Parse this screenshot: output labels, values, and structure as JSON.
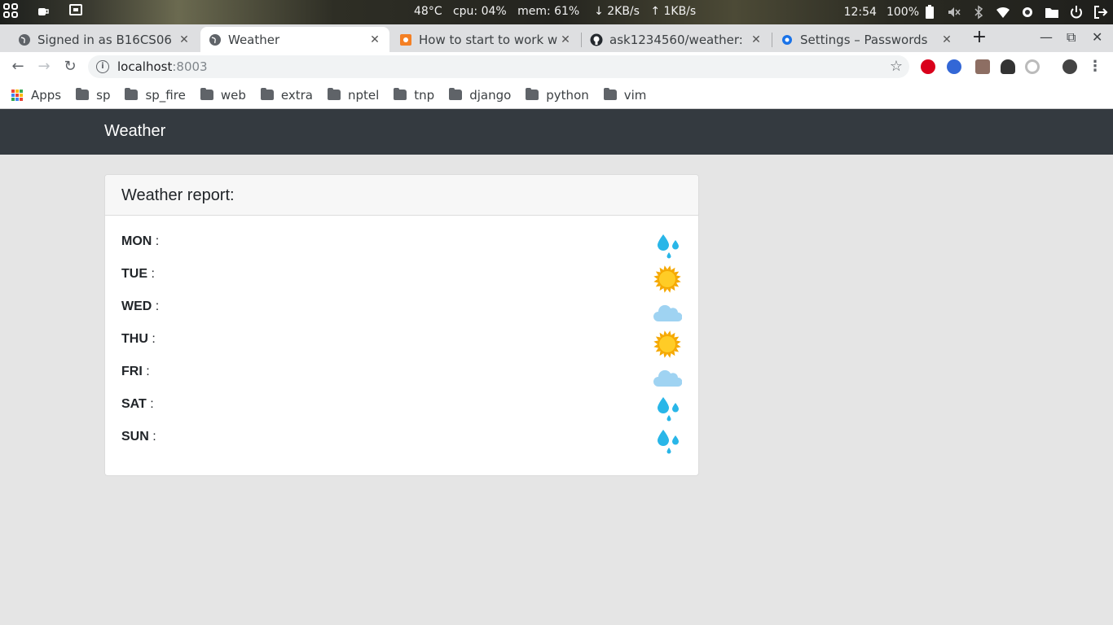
{
  "os_bar": {
    "temperature": "48°C",
    "cpu": "cpu: 04%",
    "mem": "mem: 61%",
    "down": "↓  2KB/s",
    "up": "↑  1KB/s",
    "time": "12:54",
    "battery": "100%"
  },
  "tabs": [
    {
      "title": "Signed in as B16CS06",
      "icon": "globe-icon",
      "active": false
    },
    {
      "title": "Weather",
      "icon": "globe-icon",
      "active": true
    },
    {
      "title": "How to start to work w",
      "icon": "orange-site-icon",
      "active": false
    },
    {
      "title": "ask1234560/weather:",
      "icon": "github-icon",
      "active": false
    },
    {
      "title": "Settings – Passwords",
      "icon": "settings-gear-icon",
      "active": false
    }
  ],
  "address_bar": {
    "host": "localhost",
    "port": ":8003"
  },
  "bookmarks": {
    "apps_label": "Apps",
    "folders": [
      "sp",
      "sp_fire",
      "web",
      "extra",
      "nptel",
      "tnp",
      "django",
      "python",
      "vim"
    ]
  },
  "page": {
    "brand": "Weather",
    "card_title": "Weather report:",
    "days": [
      {
        "name": "MON",
        "suffix": " :",
        "weather": "rain"
      },
      {
        "name": "TUE",
        "suffix": " :",
        "weather": "sun"
      },
      {
        "name": "WED",
        "suffix": " :",
        "weather": "cloud"
      },
      {
        "name": "THU",
        "suffix": " :",
        "weather": "sun"
      },
      {
        "name": "FRI",
        "suffix": " :",
        "weather": "cloud"
      },
      {
        "name": "SAT",
        "suffix": " :",
        "weather": "rain"
      },
      {
        "name": "SUN",
        "suffix": " :",
        "weather": "rain"
      }
    ]
  },
  "colors": {
    "navbar": "#343a40",
    "page_bg": "#e5e5e5",
    "rain": "#29b6e8",
    "sun": "#f5a800",
    "cloud": "#9fd3f2"
  }
}
